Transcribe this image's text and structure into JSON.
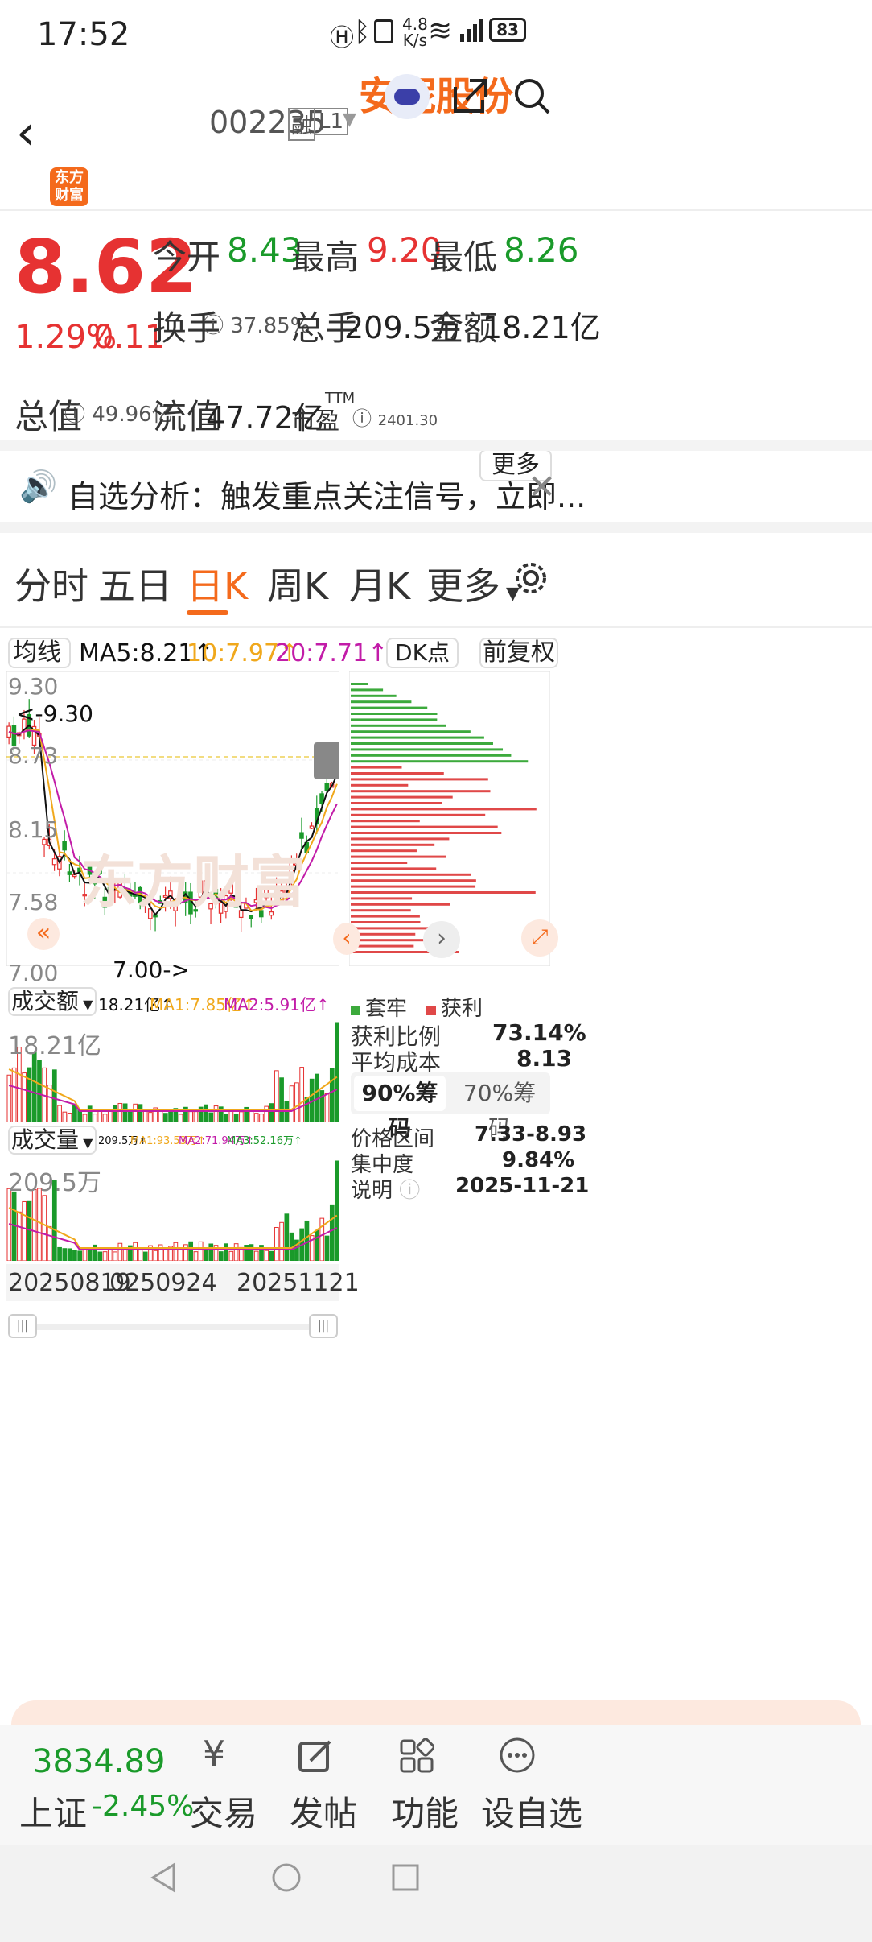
{
  "statusbar": {
    "time": "17:52",
    "net_speed_top": "4.8",
    "net_speed_bottom": "K/s",
    "battery": "83"
  },
  "header": {
    "stock_name": "安妮股份",
    "stock_code": "002235",
    "badge_rong": "融",
    "badge_level": "L1",
    "logo_line1": "东方",
    "logo_line2": "财富"
  },
  "quote": {
    "price": "8.62",
    "change_pct": "1.29%",
    "change_amt": "0.11",
    "open_label": "今开",
    "open": "8.43",
    "high_label": "最高",
    "high": "9.20",
    "low_label": "最低",
    "low": "8.26",
    "turnover_label": "换手",
    "turnover": "37.85%",
    "volume_label": "总手",
    "volume": "209.5万",
    "amount_label": "金额",
    "amount": "18.21亿",
    "mktcap_label": "总值",
    "mktcap": "49.96亿",
    "float_label": "流值",
    "float_cap": "47.72亿",
    "pe_label": "市盈",
    "pe_sup": "TTM",
    "pe": "2401.30",
    "more": "更多"
  },
  "notice": {
    "text": "自选分析：触发重点关注信号，立即..."
  },
  "tabs": {
    "items": [
      "分时",
      "五日",
      "日K",
      "周K",
      "月K",
      "更多"
    ],
    "active": 2
  },
  "kline": {
    "ma_selector": "均线",
    "ma5": "MA5:8.21",
    "ma10": "10:7.97",
    "ma20": "20:7.71",
    "dk_label": "DK点",
    "adj_label": "前复权",
    "price_max": "9.30",
    "price_2": "8.73",
    "price_3": "8.15",
    "price_4": "7.58",
    "price_min": "7.00",
    "high_mark": "<-9.30",
    "low_mark": "7.00->",
    "watermark": "东方财富",
    "colors": {
      "up": "#e63232",
      "down": "#1a9a2a",
      "ma5": "#111111",
      "ma10": "#f0a81c",
      "ma20": "#c21ca8"
    }
  },
  "amount_panel": {
    "selector": "成交额",
    "value": "18.21亿",
    "ma1": "MA1:7.85亿",
    "ma2": "MA2:5.91亿",
    "axis_max": "18.21亿"
  },
  "volume_panel": {
    "selector": "成交量",
    "value": "209.5万",
    "ma1": "MA1:93.53万",
    "ma2": "MA2:71.94万",
    "ma3": "MA3:52.16万",
    "axis_max": "209.5万"
  },
  "dates": {
    "d1": "20250819",
    "d2": "0250924",
    "d3": "20251121"
  },
  "chips": {
    "legend_loss": "套牢",
    "legend_profit": "获利",
    "profit_ratio_label": "获利比例",
    "profit_ratio": "73.14%",
    "avg_cost_label": "平均成本",
    "avg_cost": "8.13",
    "tab90": "90%筹码",
    "tab70": "70%筹码",
    "range_label": "价格区间",
    "range": "7.33-8.93",
    "concentration_label": "集中度",
    "concentration": "9.84%",
    "note_label": "说明",
    "note_date": "2025-11-21"
  },
  "bottomnav": {
    "index_value": "3834.89",
    "index_name": "上证",
    "index_change": "-2.45%",
    "trade": "交易",
    "post": "发帖",
    "functions": "功能",
    "watchlist": "设自选"
  }
}
